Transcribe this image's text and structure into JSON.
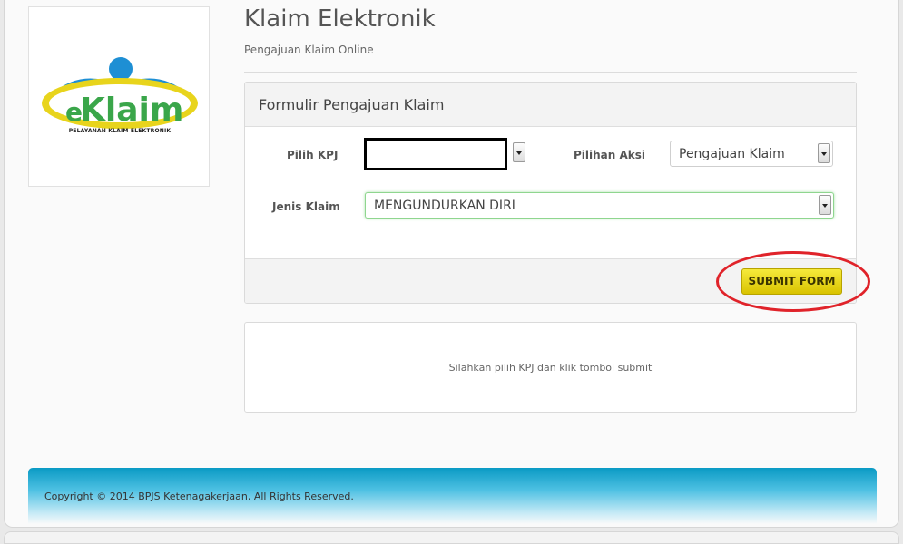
{
  "logo": {
    "wordmark_prefix": "e",
    "wordmark_main": "Klaim",
    "tagline": "PELAYANAN KLAIM ELEKTRONIK",
    "colors": {
      "blue": "#1e8fd4",
      "green": "#3aa64a",
      "yellow": "#e8d41c"
    }
  },
  "header": {
    "title": "Klaim Elektronik",
    "subtitle": "Pengajuan Klaim Online"
  },
  "form": {
    "panel_title": "Formulir Pengajuan Klaim",
    "kpj": {
      "label": "Pilih KPJ",
      "value": ""
    },
    "aksi": {
      "label": "Pilihan Aksi",
      "value": "Pengajuan Klaim"
    },
    "jenis": {
      "label": "Jenis Klaim",
      "value": "MENGUNDURKAN DIRI"
    },
    "submit_label": "SUBMIT FORM",
    "icons": {
      "dropdown": "chevron-down-icon"
    }
  },
  "info": {
    "message": "Silahkan pilih KPJ dan klik tombol submit"
  },
  "footer": {
    "copyright": "Copyright © 2014 BPJS Ketenagakerjaan, All Rights Reserved."
  },
  "colors": {
    "submit_button": "#e8d41c",
    "highlight_ring": "#e0232a",
    "footer_bar": "#0a9ac4",
    "focus_border": "#8fd68f"
  }
}
